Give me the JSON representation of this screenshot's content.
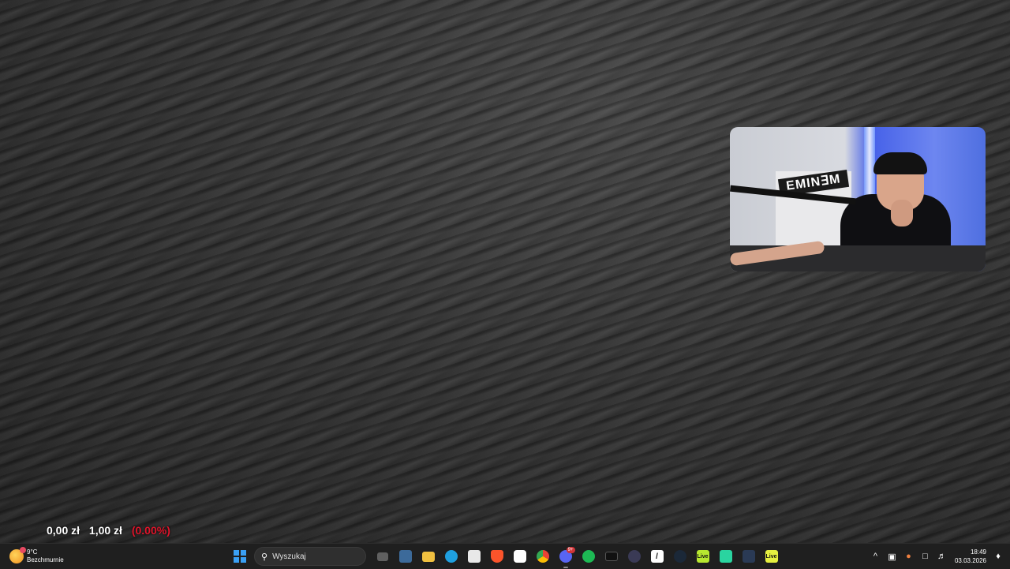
{
  "desktop": {
    "wallpaper": "dark-sand-dunes"
  },
  "webcam": {
    "poster_text": "EMIN∃M"
  },
  "stock_widget": {
    "price_a": "0,00 zł",
    "price_b": "1,00 zł",
    "change": "(0.00%)",
    "change_color": "#e0152b"
  },
  "taskbar": {
    "weather": {
      "temp": "9°C",
      "condition": "Bezchmurnie",
      "icon": "sun-icon"
    },
    "search_placeholder": "Wyszukaj",
    "apps": [
      {
        "name": "start-button",
        "icon": "windows-logo-icon"
      },
      {
        "name": "task-view-button",
        "icon": "task-view-icon"
      },
      {
        "name": "widgets-button",
        "icon": "widgets-icon"
      },
      {
        "name": "file-explorer-button",
        "icon": "folder-icon",
        "color": "#f0c040"
      },
      {
        "name": "edge-button",
        "icon": "edge-icon",
        "color": "#1fa0e0"
      },
      {
        "name": "store-button",
        "icon": "store-icon"
      },
      {
        "name": "brave-button",
        "icon": "brave-icon",
        "color": "#fb542b"
      },
      {
        "name": "onedrive-button",
        "icon": "cloud-icon"
      },
      {
        "name": "chrome-button",
        "icon": "chrome-icon"
      },
      {
        "name": "discord-button",
        "icon": "discord-icon",
        "color": "#5865f2",
        "badge": "9+"
      },
      {
        "name": "spotify-button",
        "icon": "spotify-icon",
        "color": "#1db954"
      },
      {
        "name": "terminal-button",
        "icon": "terminal-icon"
      },
      {
        "name": "app-dots-button",
        "icon": "dots-icon"
      },
      {
        "name": "epic-games-button",
        "icon": "epic-icon"
      },
      {
        "name": "steam-button",
        "icon": "steam-icon"
      },
      {
        "name": "live-button",
        "icon": "live-icon",
        "label": "Live",
        "color": "#b8e830"
      },
      {
        "name": "obs-button",
        "icon": "camera-icon",
        "color": "#2ad4a0"
      },
      {
        "name": "davinci-button",
        "icon": "davinci-icon"
      },
      {
        "name": "live-button-2",
        "icon": "live-icon",
        "label": "Live",
        "color": "#e6f040"
      }
    ],
    "tray": {
      "chevron": "^",
      "time": "18:49",
      "date": "03.03.2026"
    }
  }
}
